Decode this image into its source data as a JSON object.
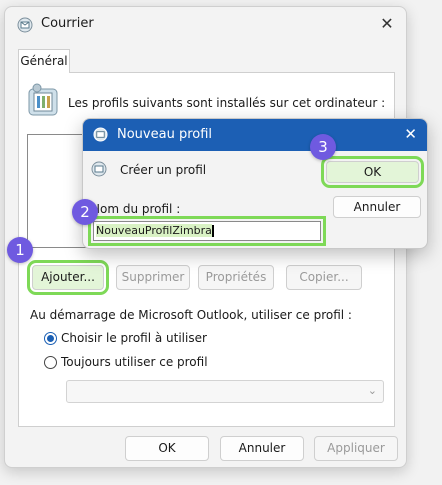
{
  "window": {
    "title": "Courrier",
    "tab": "Général"
  },
  "main": {
    "installed_text": "Les profils suivants sont installés sur cet ordinateur :",
    "buttons": {
      "add": "Ajouter...",
      "remove": "Supprimer",
      "properties": "Propriétés",
      "copy": "Copier..."
    },
    "startup_text": "Au démarrage de Microsoft Outlook, utiliser ce profil :",
    "radio_choose": "Choisir le profil à utiliser",
    "radio_always": "Toujours utiliser ce profil",
    "startup_option": "Choisir le profil à utiliser",
    "combo_value": ""
  },
  "footer": {
    "ok": "OK",
    "cancel": "Annuler",
    "apply": "Appliquer"
  },
  "dialog": {
    "title": "Nouveau profil",
    "create_text": "Créer un profil",
    "name_label": "Nom du profil :",
    "name_value": "NouveauProfilZimbra",
    "ok": "OK",
    "cancel": "Annuler"
  },
  "steps": [
    "1",
    "2",
    "3"
  ],
  "colors": {
    "dialog_title_bg": "#1c5fb4",
    "highlight": "#7ed957",
    "badge": "#6f5ae0"
  },
  "icons": {
    "app": "mail-profile-icon",
    "close": "close-icon",
    "profiles": "mail-profiles-icon",
    "chevron": "chevron-down-icon"
  }
}
